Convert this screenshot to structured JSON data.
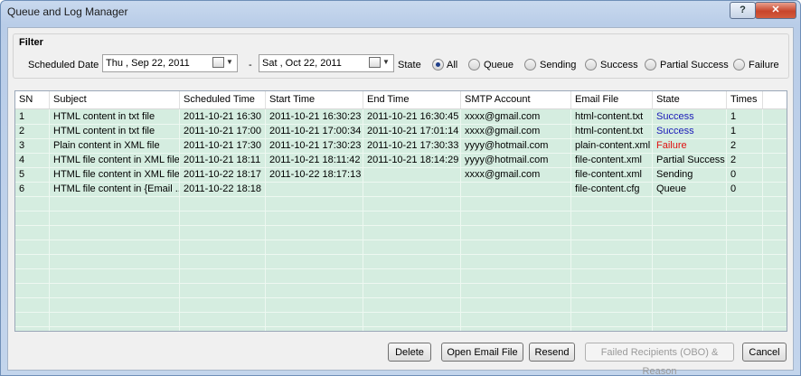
{
  "window": {
    "title": "Queue and Log Manager",
    "help_label": "?",
    "close_label": "✕"
  },
  "filter": {
    "title": "Filter",
    "scheduled_date_label": "Scheduled Date",
    "from_date": "Thu , Sep 22, 2011",
    "separator": "-",
    "to_date": "Sat , Oct 22, 2011",
    "state_label": "State",
    "states": [
      "All",
      "Queue",
      "Sending",
      "Success",
      "Partial Success",
      "Failure"
    ],
    "selected_state": "All"
  },
  "table": {
    "columns": [
      "SN",
      "Subject",
      "Scheduled Time",
      "Start Time",
      "End Time",
      "SMTP Account",
      "Email File",
      "State",
      "Times"
    ],
    "rows": [
      [
        "1",
        "HTML content in txt file",
        "2011-10-21 16:30",
        "2011-10-21 16:30:23",
        "2011-10-21 16:30:45",
        "xxxx@gmail.com",
        "html-content.txt",
        "Success",
        "1"
      ],
      [
        "2",
        "HTML content in txt file",
        "2011-10-21 17:00",
        "2011-10-21 17:00:34",
        "2011-10-21 17:01:14",
        "xxxx@gmail.com",
        "html-content.txt",
        "Success",
        "1"
      ],
      [
        "3",
        "Plain content in XML file",
        "2011-10-21 17:30",
        "2011-10-21 17:30:23",
        "2011-10-21 17:30:33",
        "yyyy@hotmail.com",
        "plain-content.xml",
        "Failure",
        "2"
      ],
      [
        "4",
        "HTML file content in XML file",
        "2011-10-21 18:11",
        "2011-10-21 18:11:42",
        "2011-10-21 18:14:29",
        "yyyy@hotmail.com",
        "file-content.xml",
        "Partial Success",
        "2"
      ],
      [
        "5",
        "HTML file content in XML file",
        "2011-10-22 18:17",
        "2011-10-22 18:17:13",
        "",
        "xxxx@gmail.com",
        "file-content.xml",
        "Sending",
        "0"
      ],
      [
        "6",
        "HTML file content in {Email ...",
        "2011-10-22 18:18",
        "",
        "",
        "",
        "file-content.cfg",
        "Queue",
        "0"
      ]
    ],
    "state_colors": {
      "Success": "#1a1ab8",
      "Failure": "#e01010",
      "Partial Success": "#000000",
      "Sending": "#000000",
      "Queue": "#000000"
    }
  },
  "buttons": {
    "delete": "Delete",
    "open_email_file": "Open Email File",
    "resend": "Resend",
    "failed_recipients": "Failed Recipients (OBO) & Reason",
    "cancel": "Cancel"
  }
}
